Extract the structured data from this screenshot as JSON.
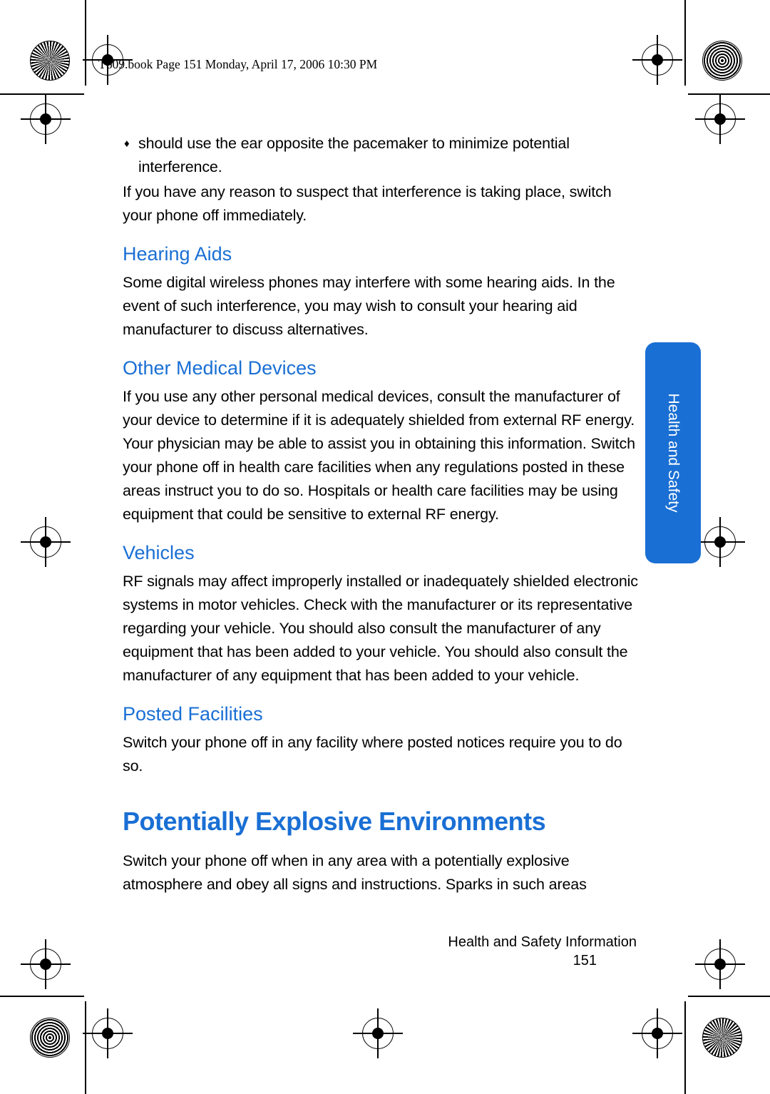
{
  "page": {
    "header": "T609.book  Page 151  Monday, April 17, 2006  10:30 PM",
    "paragraphs": {
      "bullet_text": "should use the ear opposite the pacemaker to minimize potential interference.",
      "intro": "If you have any reason to suspect that interference is taking place, switch your phone off immediately.",
      "hearing_aids_body": "Some digital wireless phones may interfere with some hearing aids. In the event of such interference, you may wish to consult your hearing aid manufacturer to discuss alternatives.",
      "other_medical_body": "If you use any other personal medical devices, consult the manufacturer of your device to determine if it is adequately shielded from external RF energy. Your physician may be able to assist you in obtaining this information. Switch your phone off in health care facilities when any regulations posted in these areas instruct you to do so. Hospitals or health care facilities may be using equipment that could be sensitive to external RF energy.",
      "vehicles_body": "RF signals may affect improperly installed or inadequately shielded electronic systems in motor vehicles. Check with the manufacturer or its representative regarding your vehicle. You should also consult the manufacturer of any equipment that has been added to your vehicle. You should also consult the manufacturer of any equipment that has been added to your vehicle.",
      "posted_facilities_body": "Switch your phone off in any facility where posted notices require you to do so.",
      "explosive_body": "Switch your phone off when in any area with a potentially explosive atmosphere and obey all signs and instructions. Sparks in such areas"
    },
    "headings": {
      "hearing_aids": "Hearing Aids",
      "other_medical_devices": "Other Medical Devices",
      "vehicles": "Vehicles",
      "posted_facilities": "Posted Facilities"
    },
    "title": "Potentially Explosive Environments",
    "side_tab": "Health and Safety",
    "footer": {
      "chapter": "Health and Safety Information",
      "page_number": "151"
    },
    "bullet_glyph": "♦",
    "colors": {
      "accent_blue": "#1a6fd4",
      "text_black": "#000000",
      "page_white": "#ffffff"
    }
  }
}
